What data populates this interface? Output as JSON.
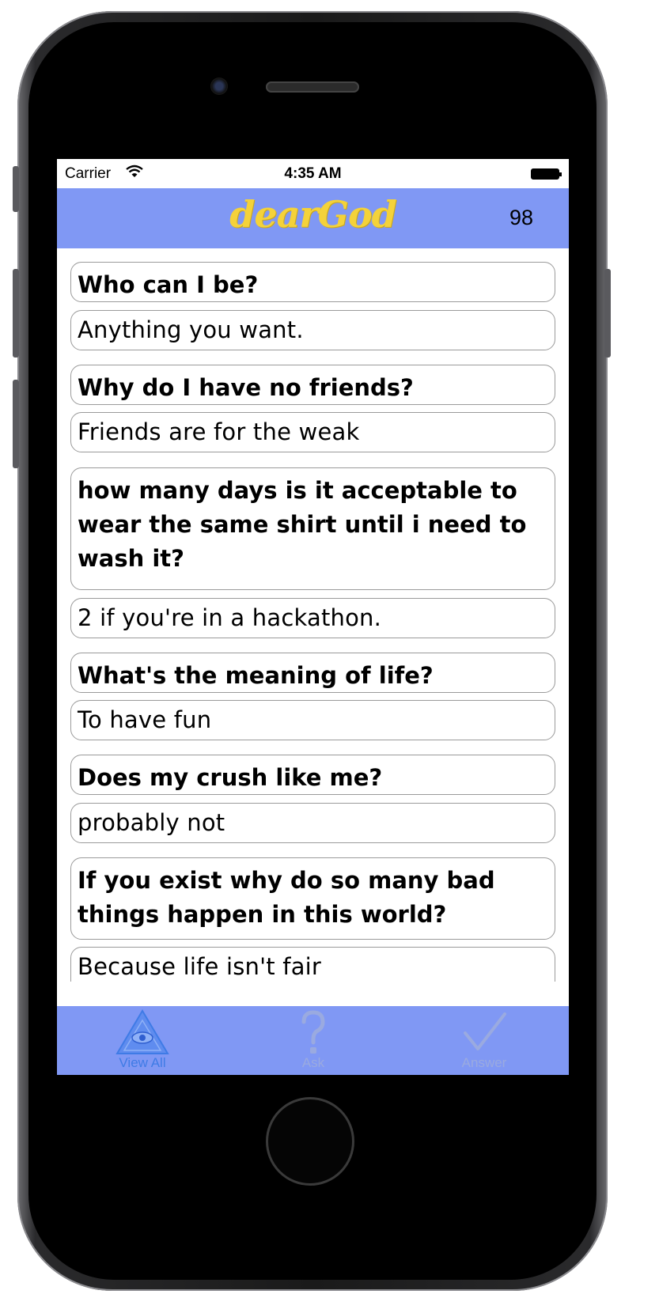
{
  "status_bar": {
    "carrier": "Carrier",
    "time": "4:35 AM"
  },
  "header": {
    "logo": "dearGod",
    "count": "98",
    "logo_color": "#f4d23a",
    "bar_color": "#8098f4"
  },
  "items": [
    {
      "question": "Who can I be?",
      "answer": "Anything you want."
    },
    {
      "question": "Why do I have no friends?",
      "answer": "Friends are for the weak"
    },
    {
      "question": "how many days is it acceptable to wear the same shirt until i need to wash it?",
      "answer": "2 if you're in a hackathon."
    },
    {
      "question": "What's the meaning of life?",
      "answer": "To have fun"
    },
    {
      "question": "Does my crush like me?",
      "answer": "probably not"
    },
    {
      "question": "If you exist why do so many bad things happen in this world?",
      "answer": "Because life isn't fair"
    }
  ],
  "tabs": [
    {
      "label": "View All",
      "icon": "eye-pyramid-icon",
      "selected": true,
      "color": "#3f7be6"
    },
    {
      "label": "Ask",
      "icon": "question-mark-icon",
      "selected": false,
      "color": "#9aaae0"
    },
    {
      "label": "Answer",
      "icon": "checkmark-icon",
      "selected": false,
      "color": "#9aaae0"
    }
  ]
}
